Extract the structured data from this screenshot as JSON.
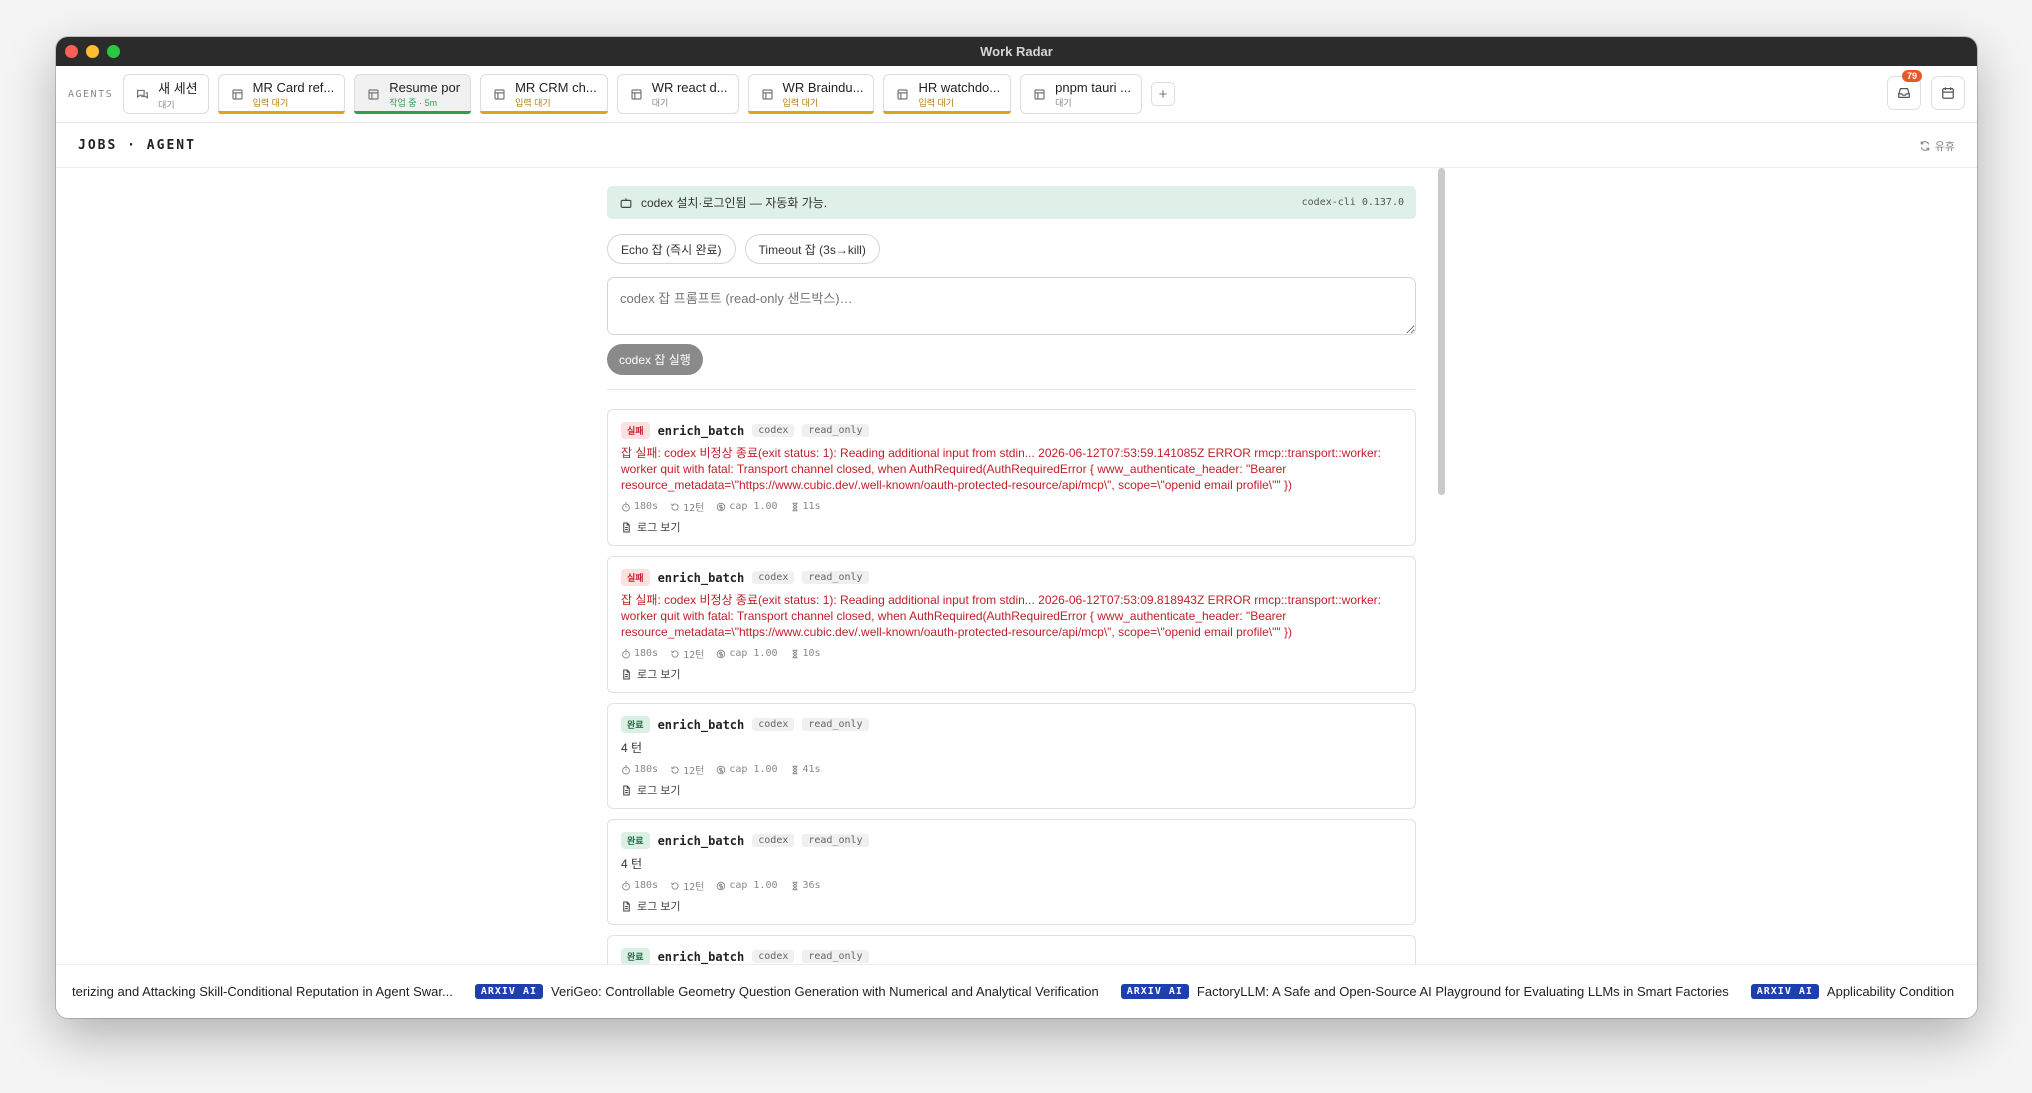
{
  "window": {
    "title": "Work Radar"
  },
  "agents_bar": {
    "label": "AGENTS",
    "tabs": [
      {
        "name": "새 세션",
        "status": "대기",
        "kind": "chat",
        "underline": "",
        "selected": false
      },
      {
        "name": "MR Card ref...",
        "status": "입력 대기",
        "kind": "doc",
        "underline": "#e0a21a",
        "selected": false
      },
      {
        "name": "Resume por",
        "status": "작업 중 · 5m",
        "kind": "doc",
        "underline": "#2f9e54",
        "selected": true
      },
      {
        "name": "MR CRM ch...",
        "status": "입력 대기",
        "kind": "doc",
        "underline": "#e0a21a",
        "selected": false
      },
      {
        "name": "WR react d...",
        "status": "대기",
        "kind": "doc",
        "underline": "",
        "selected": false
      },
      {
        "name": "WR Braindu...",
        "status": "입력 대기",
        "kind": "doc",
        "underline": "#e0a21a",
        "selected": false
      },
      {
        "name": "HR watchdo...",
        "status": "입력 대기",
        "kind": "doc",
        "underline": "#e0a21a",
        "selected": false
      },
      {
        "name": "pnpm tauri ...",
        "status": "대기",
        "kind": "doc",
        "underline": "",
        "selected": false
      }
    ],
    "add_label": "+",
    "inbox_badge": "79"
  },
  "jobs_bar": {
    "title": "JOBS · AGENT",
    "idle_label": "유휴"
  },
  "notice": {
    "text": "codex 설치·로그인됨 — 자동화 가능.",
    "version": "codex-cli 0.137.0"
  },
  "quick_buttons": {
    "echo": "Echo 잡 (즉시 완료)",
    "timeout": "Timeout 잡 (3s→kill)"
  },
  "prompt": {
    "placeholder": "codex 잡 프롬프트 (read-only 샌드박스)…",
    "run_label": "codex 잡 실행"
  },
  "jobs": [
    {
      "status": "실패",
      "status_kind": "fail",
      "name": "enrich_batch",
      "tags": [
        "codex",
        "read_only"
      ],
      "message": "잡 실패: codex 비정상 종료(exit status: 1): Reading additional input from stdin... 2026-06-12T07:53:59.141085Z ERROR rmcp::transport::worker: worker quit with fatal: Transport channel closed, when AuthRequired(AuthRequiredError { www_authenticate_header: \"Bearer resource_metadata=\\\"https://www.cubic.dev/.well-known/oauth-protected-resource/api/mcp\\\", scope=\\\"openid email profile\\\"\" })",
      "timeout": "180s",
      "turns": "12턴",
      "cap": "cap 1.00",
      "duration": "11s",
      "log_label": "로그 보기"
    },
    {
      "status": "실패",
      "status_kind": "fail",
      "name": "enrich_batch",
      "tags": [
        "codex",
        "read_only"
      ],
      "message": "잡 실패: codex 비정상 종료(exit status: 1): Reading additional input from stdin... 2026-06-12T07:53:09.818943Z ERROR rmcp::transport::worker: worker quit with fatal: Transport channel closed, when AuthRequired(AuthRequiredError { www_authenticate_header: \"Bearer resource_metadata=\\\"https://www.cubic.dev/.well-known/oauth-protected-resource/api/mcp\\\", scope=\\\"openid email profile\\\"\" })",
      "timeout": "180s",
      "turns": "12턴",
      "cap": "cap 1.00",
      "duration": "10s",
      "log_label": "로그 보기"
    },
    {
      "status": "완료",
      "status_kind": "done",
      "name": "enrich_batch",
      "tags": [
        "codex",
        "read_only"
      ],
      "result": "4 턴",
      "timeout": "180s",
      "turns": "12턴",
      "cap": "cap 1.00",
      "duration": "41s",
      "log_label": "로그 보기"
    },
    {
      "status": "완료",
      "status_kind": "done",
      "name": "enrich_batch",
      "tags": [
        "codex",
        "read_only"
      ],
      "result": "4 턴",
      "timeout": "180s",
      "turns": "12턴",
      "cap": "cap 1.00",
      "duration": "36s",
      "log_label": "로그 보기"
    },
    {
      "status": "완료",
      "status_kind": "done",
      "name": "enrich_batch",
      "tags": [
        "codex",
        "read_only"
      ],
      "result": "",
      "timeout": "",
      "turns": "",
      "cap": "",
      "duration": "",
      "log_label": ""
    }
  ],
  "ticker": [
    {
      "tag": "",
      "text": "terizing and Attacking Skill-Conditional Reputation in Agent Swar..."
    },
    {
      "tag": "ARXIV AI",
      "text": "VeriGeo: Controllable Geometry Question Generation with Numerical and Analytical Verification"
    },
    {
      "tag": "ARXIV AI",
      "text": "FactoryLLM: A Safe and Open-Source AI Playground for Evaluating LLMs in Smart Factories"
    },
    {
      "tag": "ARXIV AI",
      "text": "Applicability Condition"
    }
  ]
}
